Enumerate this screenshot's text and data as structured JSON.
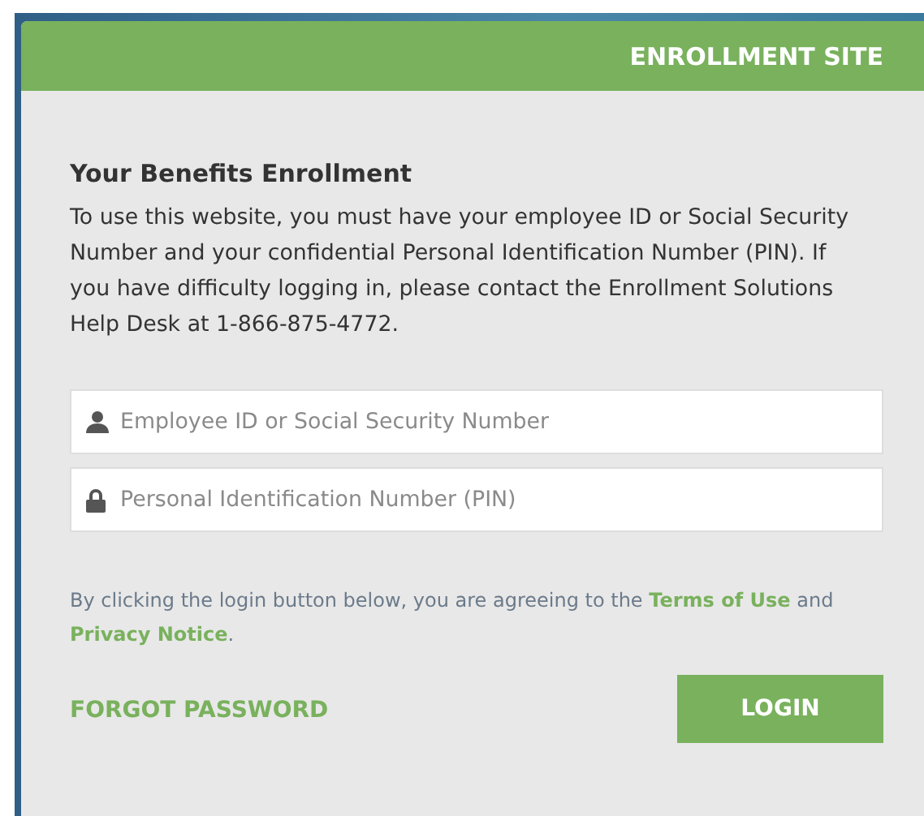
{
  "header": {
    "title": "ENROLLMENT SITE"
  },
  "intro": {
    "heading": "Your Benefits Enrollment",
    "text": "To use this website, you must have your employee ID or Social Security Number and your confidential Personal Identification Number (PIN). If you have difficulty logging in, please contact the Enrollment Solutions Help Desk at 1-866-875-4772."
  },
  "fields": [
    {
      "kind": "user",
      "placeholder": "Employee ID or Social Security Number"
    },
    {
      "kind": "lock",
      "placeholder": "Personal Identification Number (PIN)"
    }
  ],
  "consent": {
    "before": "By clicking the login button below, you are agreeing to the",
    "terms_link": "Terms of Use",
    "middle": "and",
    "privacy_link": "Privacy Notice",
    "after": "."
  },
  "forgot_link": "FORGOT PASSWORD",
  "login_button": "LOGIN"
}
